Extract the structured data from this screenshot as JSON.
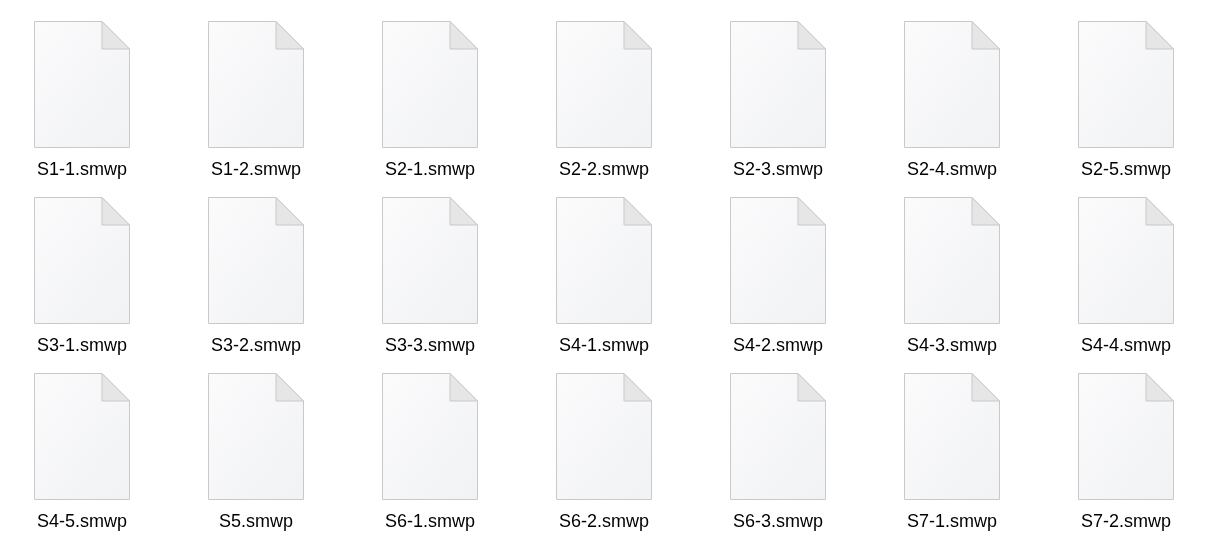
{
  "files": [
    {
      "name": "S1-1.smwp"
    },
    {
      "name": "S1-2.smwp"
    },
    {
      "name": "S2-1.smwp"
    },
    {
      "name": "S2-2.smwp"
    },
    {
      "name": "S2-3.smwp"
    },
    {
      "name": "S2-4.smwp"
    },
    {
      "name": "S2-5.smwp"
    },
    {
      "name": "S3-1.smwp"
    },
    {
      "name": "S3-2.smwp"
    },
    {
      "name": "S3-3.smwp"
    },
    {
      "name": "S4-1.smwp"
    },
    {
      "name": "S4-2.smwp"
    },
    {
      "name": "S4-3.smwp"
    },
    {
      "name": "S4-4.smwp"
    },
    {
      "name": "S4-5.smwp"
    },
    {
      "name": "S5.smwp"
    },
    {
      "name": "S6-1.smwp"
    },
    {
      "name": "S6-2.smwp"
    },
    {
      "name": "S6-3.smwp"
    },
    {
      "name": "S7-1.smwp"
    },
    {
      "name": "S7-2.smwp"
    }
  ]
}
